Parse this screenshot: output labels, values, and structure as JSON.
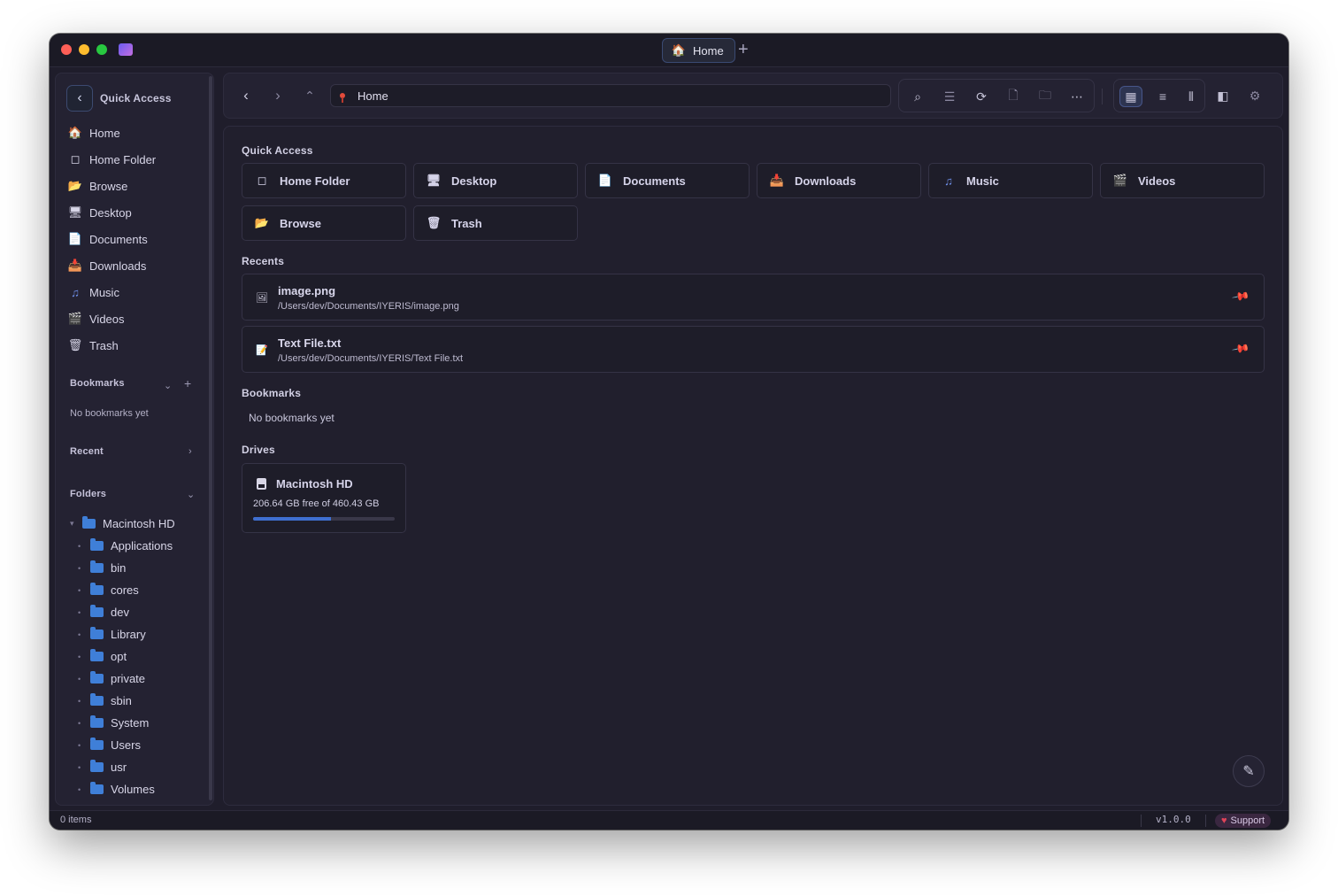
{
  "window": {
    "tab_label": "Home",
    "tab_add": "+"
  },
  "sidebar": {
    "header_label": "Quick Access",
    "items": [
      {
        "label": "Home",
        "icon": "🏠"
      },
      {
        "label": "Home Folder",
        "icon": "◻"
      },
      {
        "label": "Browse",
        "icon": "📂"
      },
      {
        "label": "Desktop",
        "icon": "🖥"
      },
      {
        "label": "Documents",
        "icon": "📄"
      },
      {
        "label": "Downloads",
        "icon": "📥"
      },
      {
        "label": "Music",
        "icon": "♫"
      },
      {
        "label": "Videos",
        "icon": "🎬"
      },
      {
        "label": "Trash",
        "icon": "🗑"
      }
    ],
    "bookmarks_title": "Bookmarks",
    "bookmarks_add": "+",
    "bookmarks_empty": "No bookmarks yet",
    "recent_title": "Recent",
    "folders_title": "Folders",
    "tree_root": "Macintosh HD",
    "tree_children": [
      "Applications",
      "bin",
      "cores",
      "dev",
      "Library",
      "opt",
      "private",
      "sbin",
      "System",
      "Users",
      "usr",
      "Volumes"
    ]
  },
  "toolbar": {
    "path": "Home"
  },
  "main": {
    "quick_access_title": "Quick Access",
    "quick_access": [
      {
        "label": "Home Folder",
        "icon": "◻"
      },
      {
        "label": "Desktop",
        "icon": "🖥"
      },
      {
        "label": "Documents",
        "icon": "📄"
      },
      {
        "label": "Downloads",
        "icon": "📥"
      },
      {
        "label": "Music",
        "icon": "♫"
      },
      {
        "label": "Videos",
        "icon": "🎬"
      },
      {
        "label": "Browse",
        "icon": "📂"
      },
      {
        "label": "Trash",
        "icon": "🗑"
      }
    ],
    "recents_title": "Recents",
    "recents": [
      {
        "name": "image.png",
        "path": "/Users/dev/Documents/IYERIS/image.png",
        "icon": "🖼"
      },
      {
        "name": "Text File.txt",
        "path": "/Users/dev/Documents/IYERIS/Text File.txt",
        "icon": "📝"
      }
    ],
    "bookmarks_title": "Bookmarks",
    "bookmarks_empty": "No bookmarks yet",
    "drives_title": "Drives",
    "drive": {
      "name": "Macintosh HD",
      "free_text": "206.64 GB free of 460.43 GB",
      "used_fraction": 0.551
    }
  },
  "status": {
    "items": "0 items",
    "version": "v1.0.0",
    "support": "Support"
  },
  "colors": {
    "accent": "#3f6fd0",
    "folder": "#3f7fd8",
    "background": "#1f1d2b"
  }
}
